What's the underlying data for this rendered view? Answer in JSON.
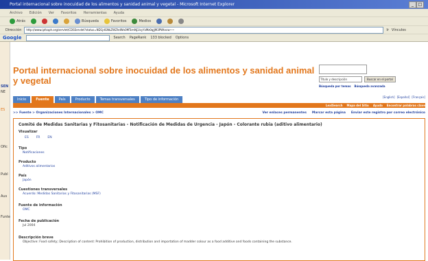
{
  "browser": {
    "window_title": "Portal internacional sobre inocuidad de los alimentos y sanidad animal y vegetal - Microsoft Internet Explorer",
    "menu": [
      "Archivo",
      "Edición",
      "Ver",
      "Favoritos",
      "Herramientas",
      "Ayuda"
    ],
    "toolbar": [
      "Atrás",
      "Búsqueda",
      "Favoritos",
      "Medios"
    ],
    "address_label": "Dirección",
    "address": "http://www.ipfsaph.org/servlet/CDSServlet?status=ND1jdGNkZWZhdWx0MTcmNj1lcyYzMz0qJjM3PWtvcw~~",
    "go_label": "Ir",
    "links_label": "Vínculos",
    "google": {
      "logo": "Google",
      "search_label": "Search",
      "pagerank_label": "PageRank",
      "blocked_label": "133 blocked",
      "options_label": "Options"
    }
  },
  "site": {
    "title": "Portal internacional sobre inocuidad de los alimentos y sanidad animal y vegetal",
    "search": {
      "select_value": "Título y descripción",
      "button": "Buscar en el portal",
      "advanced_links": [
        "Búsqueda por temas",
        "Búsqueda avanzada"
      ]
    },
    "tabs": [
      "Inicio",
      "Fuente",
      "País",
      "Producto",
      "Temas transversales",
      "Tipo de información"
    ],
    "active_tab": "Fuente",
    "languages": [
      "[English]",
      "[Español]",
      "[Français]"
    ],
    "util_links": [
      "LexiSearch",
      "Mapa del Sitio",
      "Ayuda",
      "Encontrar palabras clave"
    ],
    "breadcrumb": ">> Fuente > Organizaciones Internacionales > OMC",
    "tools": [
      "Ver enlaces permanentes",
      "Marcar esta página",
      "Enviar este registro por correo electrónico"
    ]
  },
  "record": {
    "title": "Comité de Medidas Sanitarias y Fitosanitarias - Notificación de Medidas de Urgencia - Japón - Colorante rubia (aditivo alimentario)",
    "download_label": "Visualizar",
    "formats": [
      "ES",
      "FR",
      "EN"
    ],
    "fields": [
      {
        "label": "Tipo",
        "value": "Notificaciones"
      },
      {
        "label": "Producto",
        "value": "Aditivos alimentarios"
      },
      {
        "label": "País",
        "value": "Japón"
      },
      {
        "label": "Cuestiones transversales",
        "value": "Acuerdo: Medidas Sanitarias y Fitosanitarias (MSF)"
      },
      {
        "label": "Fuente de información",
        "value": "OMC"
      },
      {
        "label": "Fecha de publicación",
        "value": "Jul 2004"
      },
      {
        "label": "Descripción breve",
        "value": "Objective: Food safety; Description of content: Prohibition of production, distribution and importation of madder colour as a food additive and foods containing the substance."
      }
    ]
  },
  "left_strip": [
    "SEN",
    "NE",
    "ES",
    "Ofic",
    "Publ",
    "Aus",
    "Funte"
  ],
  "colors": {
    "accent": "#e2771c",
    "tab": "#4d80c4",
    "link": "#1f3f9f"
  }
}
